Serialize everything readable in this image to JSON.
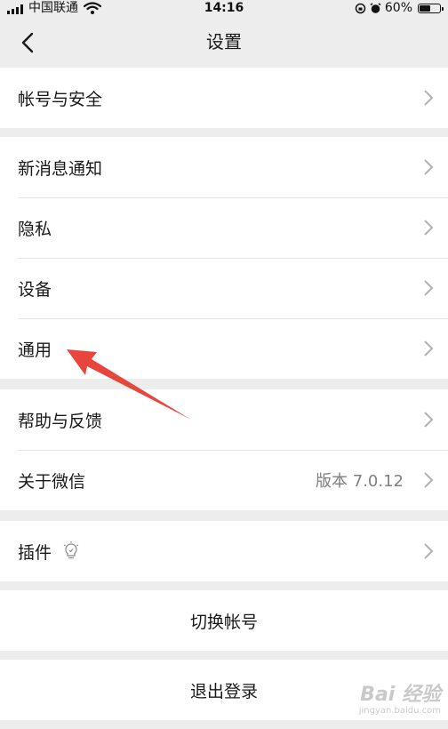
{
  "status_bar": {
    "carrier": "中国联通",
    "time": "14:16",
    "battery": "60%",
    "battery_level": 0.6,
    "icons": [
      "signal-icon",
      "wifi-icon",
      "orientation-lock-icon",
      "alarm-icon",
      "battery-icon"
    ]
  },
  "nav": {
    "title": "设置",
    "back_icon": "back-chevron-icon"
  },
  "groups": [
    {
      "items": [
        {
          "label": "帐号与安全"
        }
      ]
    },
    {
      "items": [
        {
          "label": "新消息通知"
        },
        {
          "label": "隐私"
        },
        {
          "label": "设备"
        },
        {
          "label": "通用"
        }
      ]
    },
    {
      "items": [
        {
          "label": "帮助与反馈"
        },
        {
          "label": "关于微信",
          "value": "版本 7.0.12"
        }
      ]
    },
    {
      "items": [
        {
          "label": "插件",
          "icon": "lightbulb-icon"
        }
      ]
    }
  ],
  "actions": {
    "switch_account": "切换帐号",
    "logout": "退出登录"
  },
  "annotation": {
    "arrow_color": "#e8463c",
    "points_to": "通用"
  },
  "watermark": {
    "main": "Bai 经验",
    "sub": "jingyan.baidu.com"
  },
  "colors": {
    "background": "#ededed",
    "row_background": "#ffffff",
    "secondary_text": "#808080",
    "chevron": "#b2b2b2"
  }
}
